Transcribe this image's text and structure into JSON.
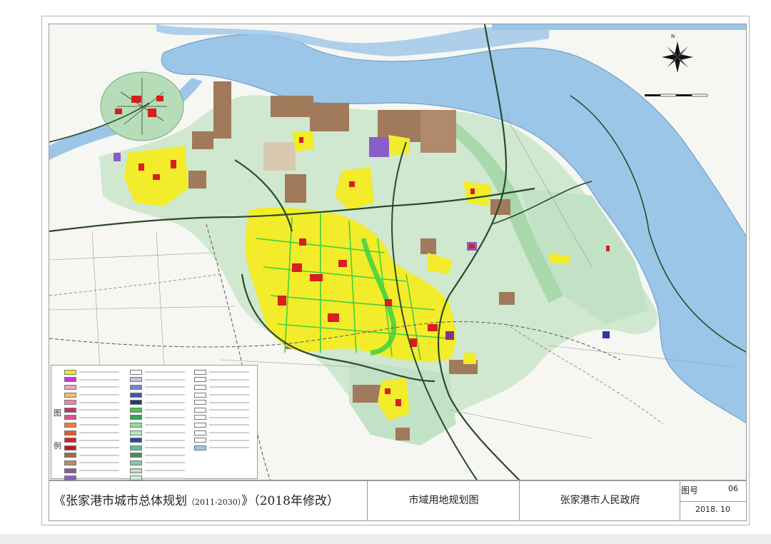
{
  "map": {
    "colors": {
      "river": "#9cc6e8",
      "river_edge": "#6fa2cc",
      "greenbelt": "#b6dcb8",
      "greenbelt_dark": "#8fcc98",
      "residential": "#f2ec2a",
      "commercial": "#d81e1e",
      "industrial": "#a07a5a",
      "park": "#3fd13f",
      "purple": "#8a5cc8",
      "road": "#2a4a2a",
      "rail": "#555555"
    },
    "labels": {
      "north": "N"
    }
  },
  "legend": {
    "title": "图 例",
    "items": [
      {
        "color": "#f4ec20"
      },
      {
        "color": "#c83ad0"
      },
      {
        "color": "#f5a0c0"
      },
      {
        "color": "#f5c060"
      },
      {
        "color": "#e88aa0"
      },
      {
        "color": "#c8305a"
      },
      {
        "color": "#e0508a"
      },
      {
        "color": "#f07a3a"
      },
      {
        "color": "#e85a2a"
      },
      {
        "color": "#d82020"
      },
      {
        "color": "#c01818"
      },
      {
        "color": "#a06a4a"
      },
      {
        "color": "#b88a70"
      },
      {
        "color": "#8a5a8a"
      },
      {
        "color": "#8a60c0"
      },
      {
        "color": "#ffffff"
      },
      {
        "color": "#c0c8e0"
      },
      {
        "color": "#7088c8"
      },
      {
        "color": "#3a5aa8"
      },
      {
        "color": "#2a3a6a"
      },
      {
        "color": "#3ad03a"
      },
      {
        "color": "#2aa84a"
      },
      {
        "color": "#90e090"
      },
      {
        "color": "#b8e8c0"
      },
      {
        "color": "#2a4aa0"
      },
      {
        "color": "#5ac0a0"
      },
      {
        "color": "#4a8a5a"
      },
      {
        "color": "#88c8a8"
      },
      {
        "color": "#c8d8c0"
      },
      {
        "color": "#d0e8d8"
      },
      {
        "color": "#ffffff"
      },
      {
        "color": "#ffffff"
      },
      {
        "color": "#ffffff"
      },
      {
        "color": "#ffffff"
      },
      {
        "color": "#ffffff"
      },
      {
        "color": "#ffffff"
      },
      {
        "color": "#ffffff"
      },
      {
        "color": "#ffffff"
      },
      {
        "color": "#ffffff"
      },
      {
        "color": "#ffffff"
      },
      {
        "color": "#9cc6e8"
      }
    ]
  },
  "titlebar": {
    "main_prefix": "《张家港市城市总体规划",
    "main_years": "（2011-2030）",
    "main_suffix": "》（2018年修改）",
    "map_name": "市域用地规划图",
    "organization": "张家港市人民政府",
    "figure_label": "图号",
    "figure_number": "06",
    "date": "2018. 10"
  }
}
